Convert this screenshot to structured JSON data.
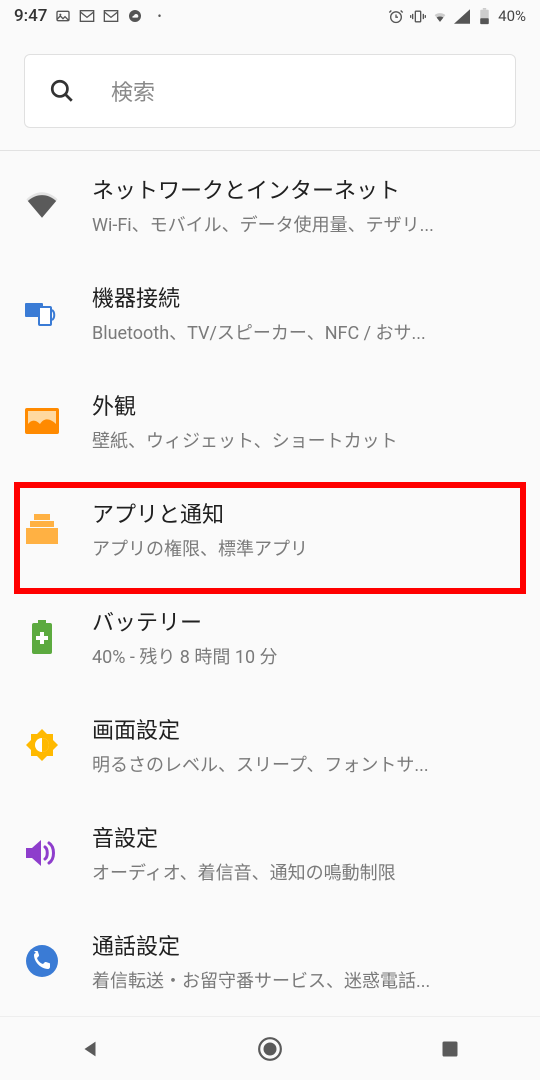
{
  "status": {
    "time": "9:47",
    "battery_pct": "40%"
  },
  "search": {
    "placeholder": "検索"
  },
  "settings": [
    {
      "id": "network",
      "title": "ネットワークとインターネット",
      "desc": "Wi-Fi、モバイル、データ使用量、テザリ..."
    },
    {
      "id": "devices",
      "title": "機器接続",
      "desc": "Bluetooth、TV/スピーカー、NFC / おサ..."
    },
    {
      "id": "display",
      "title": "外観",
      "desc": "壁紙、ウィジェット、ショートカット"
    },
    {
      "id": "apps",
      "title": "アプリと通知",
      "desc": "アプリの権限、標準アプリ"
    },
    {
      "id": "battery",
      "title": "バッテリー",
      "desc": "40% - 残り 8 時間 10 分"
    },
    {
      "id": "screen",
      "title": "画面設定",
      "desc": "明るさのレベル、スリープ、フォントサ..."
    },
    {
      "id": "sound",
      "title": "音設定",
      "desc": "オーディオ、着信音、通知の鳴動制限"
    },
    {
      "id": "call",
      "title": "通話設定",
      "desc": "着信転送・お留守番サービス、迷惑電話..."
    }
  ],
  "highlighted_index": 3
}
